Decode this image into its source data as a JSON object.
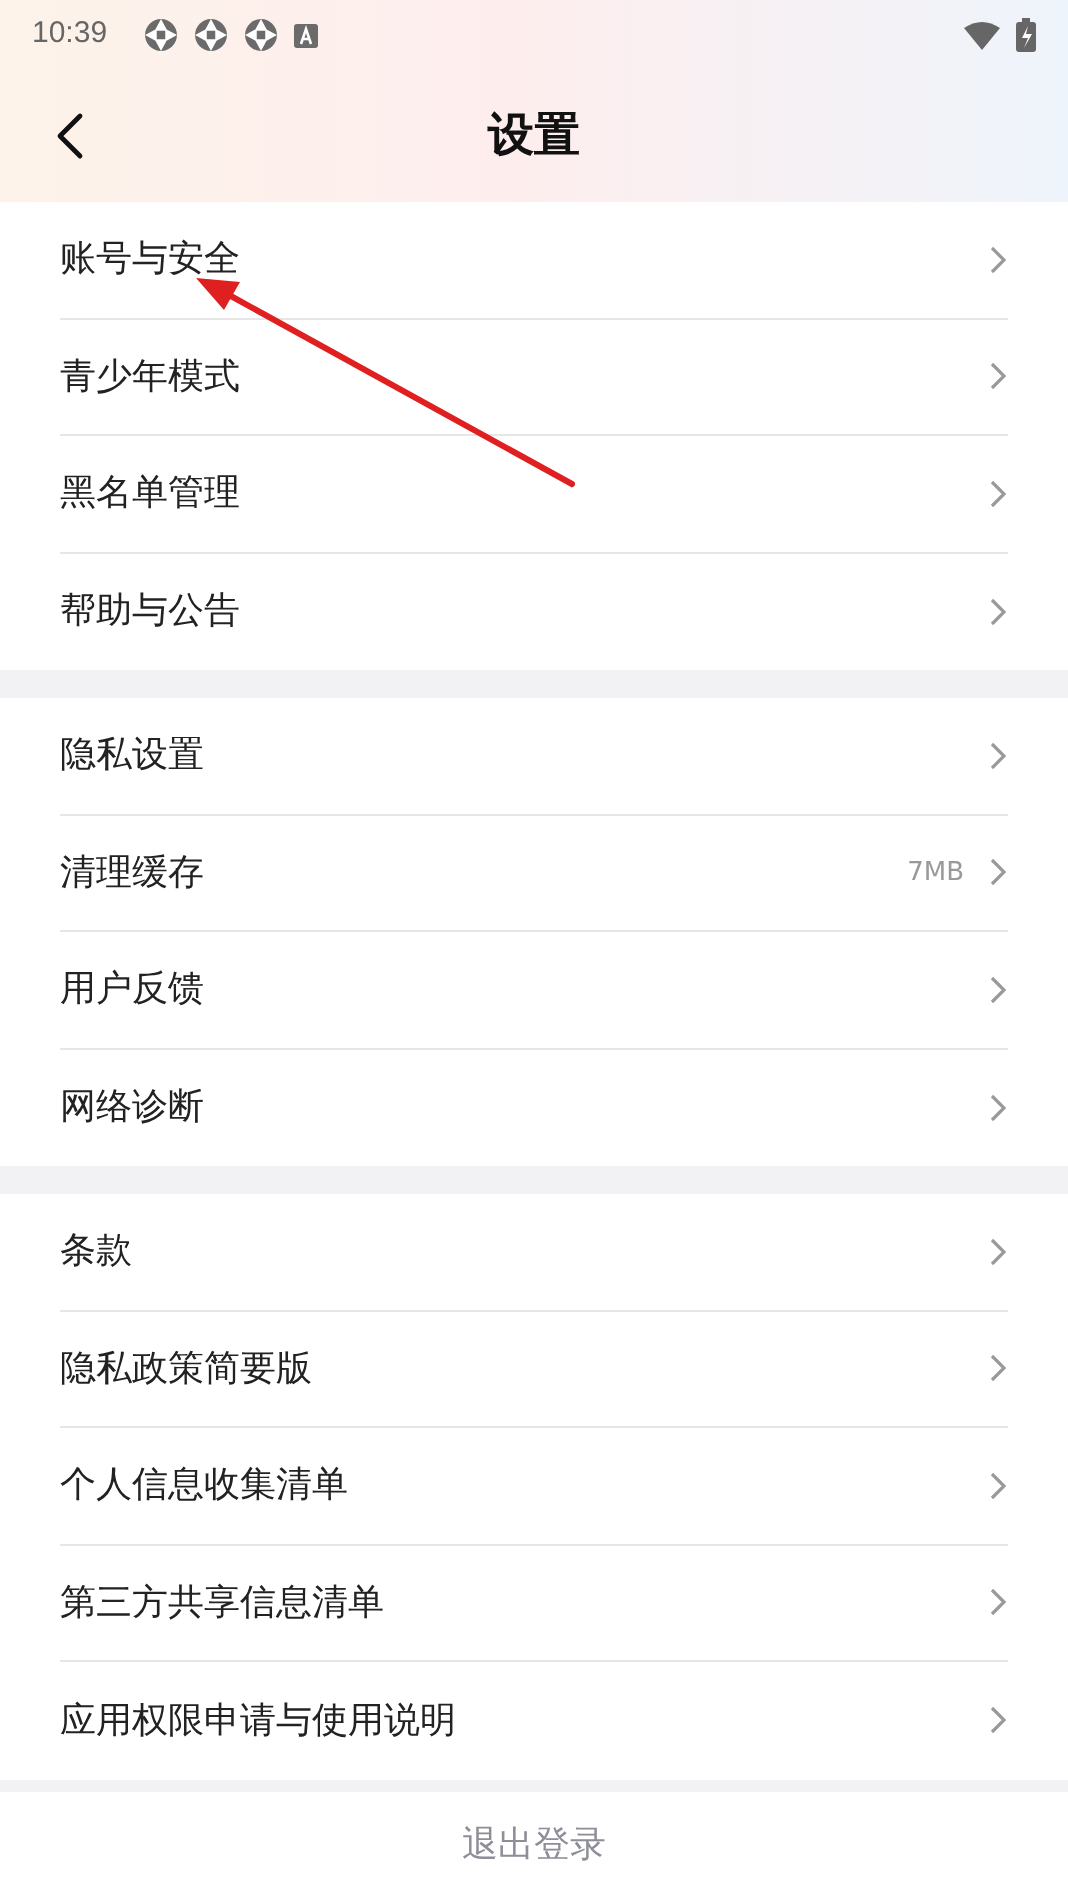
{
  "status_bar": {
    "time": "10:39",
    "notification_icons": [
      {
        "kind": "app"
      },
      {
        "kind": "app"
      },
      {
        "kind": "app"
      },
      {
        "kind": "keyboard"
      }
    ]
  },
  "header": {
    "title": "设置"
  },
  "groups": [
    {
      "items": [
        {
          "label": "账号与安全"
        },
        {
          "label": "青少年模式"
        },
        {
          "label": "黑名单管理"
        },
        {
          "label": "帮助与公告"
        }
      ]
    },
    {
      "items": [
        {
          "label": "隐私设置"
        },
        {
          "label": "清理缓存",
          "value": "7MB"
        },
        {
          "label": "用户反馈"
        },
        {
          "label": "网络诊断"
        }
      ]
    },
    {
      "items": [
        {
          "label": "条款"
        },
        {
          "label": "隐私政策简要版"
        },
        {
          "label": "个人信息收集清单"
        },
        {
          "label": "第三方共享信息清单"
        },
        {
          "label": "应用权限申请与使用说明"
        }
      ]
    }
  ],
  "logout_button": "退出登录"
}
